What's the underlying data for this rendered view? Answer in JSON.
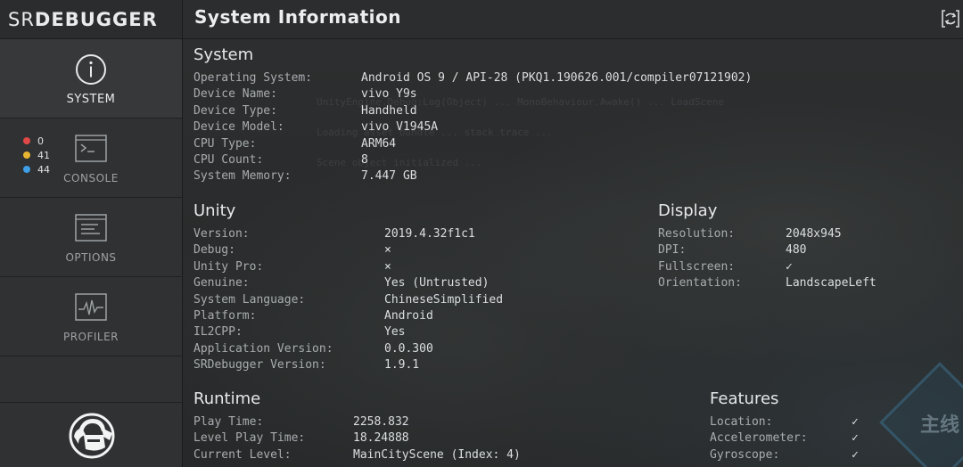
{
  "app": {
    "logo_prefix": "SR",
    "logo_main": "DEBUGGER",
    "title": "System Information"
  },
  "sidebar": {
    "items": [
      {
        "label": "SYSTEM",
        "icon": "info-icon"
      },
      {
        "label": "CONSOLE",
        "icon": "terminal-icon"
      },
      {
        "label": "OPTIONS",
        "icon": "options-icon"
      },
      {
        "label": "PROFILER",
        "icon": "profiler-icon"
      }
    ],
    "console_counts": [
      {
        "value": "0",
        "color": "#e04848"
      },
      {
        "value": "41",
        "color": "#e8b531"
      },
      {
        "value": "44",
        "color": "#3f9ee6"
      }
    ]
  },
  "sections": {
    "system": {
      "title": "System",
      "rows": [
        {
          "k": "Operating System:",
          "v": "Android OS 9 / API-28 (PKQ1.190626.001/compiler07121902)"
        },
        {
          "k": "Device Name:",
          "v": "vivo Y9s"
        },
        {
          "k": "Device Type:",
          "v": "Handheld"
        },
        {
          "k": "Device Model:",
          "v": "vivo V1945A"
        },
        {
          "k": "CPU Type:",
          "v": "ARM64"
        },
        {
          "k": "CPU Count:",
          "v": "8"
        },
        {
          "k": "System Memory:",
          "v": "7.447 GB"
        }
      ]
    },
    "unity": {
      "title": "Unity",
      "rows": [
        {
          "k": "Version:",
          "v": "2019.4.32f1c1"
        },
        {
          "k": "Debug:",
          "v": "×"
        },
        {
          "k": "Unity Pro:",
          "v": "×"
        },
        {
          "k": "Genuine:",
          "v": "Yes (Untrusted)"
        },
        {
          "k": "System Language:",
          "v": "ChineseSimplified"
        },
        {
          "k": "Platform:",
          "v": "Android"
        },
        {
          "k": "IL2CPP:",
          "v": "Yes"
        },
        {
          "k": "Application Version:",
          "v": "0.0.300"
        },
        {
          "k": "SRDebugger Version:",
          "v": "1.9.1"
        }
      ]
    },
    "display": {
      "title": "Display",
      "rows": [
        {
          "k": "Resolution:",
          "v": "2048x945"
        },
        {
          "k": "DPI:",
          "v": "480"
        },
        {
          "k": "Fullscreen:",
          "v": "✓"
        },
        {
          "k": "Orientation:",
          "v": "LandscapeLeft"
        }
      ]
    },
    "runtime": {
      "title": "Runtime",
      "rows": [
        {
          "k": "Play Time:",
          "v": "2258.832"
        },
        {
          "k": "Level Play Time:",
          "v": "18.24888"
        },
        {
          "k": "Current Level:",
          "v": "MainCityScene (Index: 4)"
        }
      ]
    },
    "features": {
      "title": "Features",
      "rows": [
        {
          "k": "Location:",
          "v": "✓"
        },
        {
          "k": "Accelerometer:",
          "v": "✓"
        },
        {
          "k": "Gyroscope:",
          "v": "✓"
        }
      ]
    }
  },
  "background": {
    "ghost_badge": "主线"
  }
}
